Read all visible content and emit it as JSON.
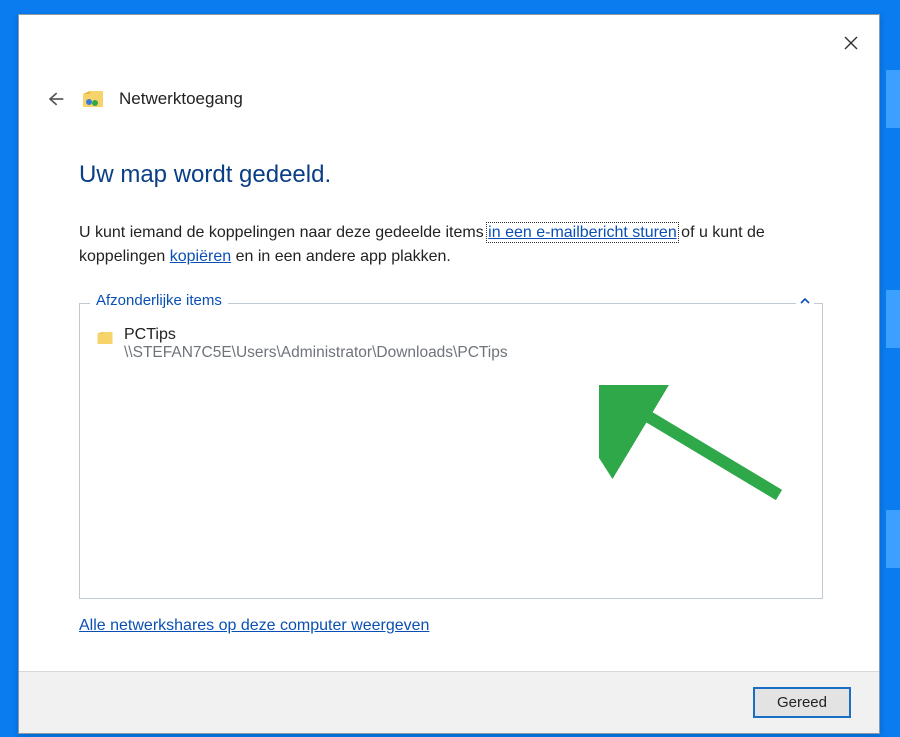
{
  "header": {
    "title": "Netwerktoegang"
  },
  "main": {
    "heading": "Uw map wordt gedeeld.",
    "desc_a": "U kunt iemand de koppelingen naar deze gedeelde items ",
    "link_email": "in een e-mailbericht sturen",
    "desc_b": " of u kunt de koppelingen ",
    "link_copy": "kopiëren",
    "desc_c": " en in een andere app plakken."
  },
  "group": {
    "legend": "Afzonderlijke items",
    "items": [
      {
        "name": "PCTips",
        "path": "\\\\STEFAN7C5E\\Users\\Administrator\\Downloads\\PCTips"
      }
    ]
  },
  "links": {
    "show_all_shares": "Alle netwerkshares op deze computer weergeven"
  },
  "buttons": {
    "done": "Gereed"
  }
}
